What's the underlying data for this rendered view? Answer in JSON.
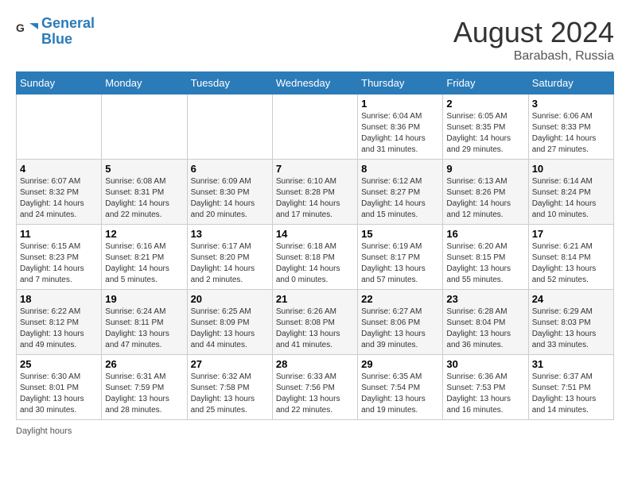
{
  "header": {
    "logo_line1": "General",
    "logo_line2": "Blue",
    "month_year": "August 2024",
    "location": "Barabash, Russia"
  },
  "days_of_week": [
    "Sunday",
    "Monday",
    "Tuesday",
    "Wednesday",
    "Thursday",
    "Friday",
    "Saturday"
  ],
  "weeks": [
    [
      {
        "day": "",
        "info": ""
      },
      {
        "day": "",
        "info": ""
      },
      {
        "day": "",
        "info": ""
      },
      {
        "day": "",
        "info": ""
      },
      {
        "day": "1",
        "info": "Sunrise: 6:04 AM\nSunset: 8:36 PM\nDaylight: 14 hours and 31 minutes."
      },
      {
        "day": "2",
        "info": "Sunrise: 6:05 AM\nSunset: 8:35 PM\nDaylight: 14 hours and 29 minutes."
      },
      {
        "day": "3",
        "info": "Sunrise: 6:06 AM\nSunset: 8:33 PM\nDaylight: 14 hours and 27 minutes."
      }
    ],
    [
      {
        "day": "4",
        "info": "Sunrise: 6:07 AM\nSunset: 8:32 PM\nDaylight: 14 hours and 24 minutes."
      },
      {
        "day": "5",
        "info": "Sunrise: 6:08 AM\nSunset: 8:31 PM\nDaylight: 14 hours and 22 minutes."
      },
      {
        "day": "6",
        "info": "Sunrise: 6:09 AM\nSunset: 8:30 PM\nDaylight: 14 hours and 20 minutes."
      },
      {
        "day": "7",
        "info": "Sunrise: 6:10 AM\nSunset: 8:28 PM\nDaylight: 14 hours and 17 minutes."
      },
      {
        "day": "8",
        "info": "Sunrise: 6:12 AM\nSunset: 8:27 PM\nDaylight: 14 hours and 15 minutes."
      },
      {
        "day": "9",
        "info": "Sunrise: 6:13 AM\nSunset: 8:26 PM\nDaylight: 14 hours and 12 minutes."
      },
      {
        "day": "10",
        "info": "Sunrise: 6:14 AM\nSunset: 8:24 PM\nDaylight: 14 hours and 10 minutes."
      }
    ],
    [
      {
        "day": "11",
        "info": "Sunrise: 6:15 AM\nSunset: 8:23 PM\nDaylight: 14 hours and 7 minutes."
      },
      {
        "day": "12",
        "info": "Sunrise: 6:16 AM\nSunset: 8:21 PM\nDaylight: 14 hours and 5 minutes."
      },
      {
        "day": "13",
        "info": "Sunrise: 6:17 AM\nSunset: 8:20 PM\nDaylight: 14 hours and 2 minutes."
      },
      {
        "day": "14",
        "info": "Sunrise: 6:18 AM\nSunset: 8:18 PM\nDaylight: 14 hours and 0 minutes."
      },
      {
        "day": "15",
        "info": "Sunrise: 6:19 AM\nSunset: 8:17 PM\nDaylight: 13 hours and 57 minutes."
      },
      {
        "day": "16",
        "info": "Sunrise: 6:20 AM\nSunset: 8:15 PM\nDaylight: 13 hours and 55 minutes."
      },
      {
        "day": "17",
        "info": "Sunrise: 6:21 AM\nSunset: 8:14 PM\nDaylight: 13 hours and 52 minutes."
      }
    ],
    [
      {
        "day": "18",
        "info": "Sunrise: 6:22 AM\nSunset: 8:12 PM\nDaylight: 13 hours and 49 minutes."
      },
      {
        "day": "19",
        "info": "Sunrise: 6:24 AM\nSunset: 8:11 PM\nDaylight: 13 hours and 47 minutes."
      },
      {
        "day": "20",
        "info": "Sunrise: 6:25 AM\nSunset: 8:09 PM\nDaylight: 13 hours and 44 minutes."
      },
      {
        "day": "21",
        "info": "Sunrise: 6:26 AM\nSunset: 8:08 PM\nDaylight: 13 hours and 41 minutes."
      },
      {
        "day": "22",
        "info": "Sunrise: 6:27 AM\nSunset: 8:06 PM\nDaylight: 13 hours and 39 minutes."
      },
      {
        "day": "23",
        "info": "Sunrise: 6:28 AM\nSunset: 8:04 PM\nDaylight: 13 hours and 36 minutes."
      },
      {
        "day": "24",
        "info": "Sunrise: 6:29 AM\nSunset: 8:03 PM\nDaylight: 13 hours and 33 minutes."
      }
    ],
    [
      {
        "day": "25",
        "info": "Sunrise: 6:30 AM\nSunset: 8:01 PM\nDaylight: 13 hours and 30 minutes."
      },
      {
        "day": "26",
        "info": "Sunrise: 6:31 AM\nSunset: 7:59 PM\nDaylight: 13 hours and 28 minutes."
      },
      {
        "day": "27",
        "info": "Sunrise: 6:32 AM\nSunset: 7:58 PM\nDaylight: 13 hours and 25 minutes."
      },
      {
        "day": "28",
        "info": "Sunrise: 6:33 AM\nSunset: 7:56 PM\nDaylight: 13 hours and 22 minutes."
      },
      {
        "day": "29",
        "info": "Sunrise: 6:35 AM\nSunset: 7:54 PM\nDaylight: 13 hours and 19 minutes."
      },
      {
        "day": "30",
        "info": "Sunrise: 6:36 AM\nSunset: 7:53 PM\nDaylight: 13 hours and 16 minutes."
      },
      {
        "day": "31",
        "info": "Sunrise: 6:37 AM\nSunset: 7:51 PM\nDaylight: 13 hours and 14 minutes."
      }
    ]
  ],
  "footer": {
    "daylight_hours_label": "Daylight hours"
  }
}
